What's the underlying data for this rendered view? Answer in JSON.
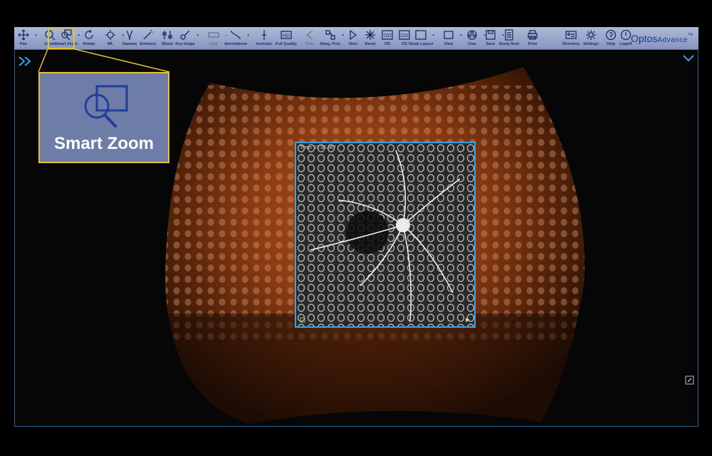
{
  "toolbar": {
    "tools": [
      {
        "label": "Pan",
        "icon": "pan-icon"
      },
      {
        "label": "Zoom",
        "icon": "zoom-icon"
      },
      {
        "label": "Smart Zoom",
        "icon": "smart-zoom-icon",
        "active": true
      },
      {
        "label": "Rotate",
        "icon": "rotate-icon"
      },
      {
        "label": "WL",
        "icon": "window-level-icon"
      },
      {
        "label": "Gamma",
        "icon": "gamma-icon"
      },
      {
        "label": "Enhance",
        "icon": "enhance-wand-icon"
      },
      {
        "label": "Blend",
        "icon": "blend-sliders-icon"
      },
      {
        "label": "Key Image",
        "icon": "key-image-icon"
      },
      {
        "label": "Link",
        "icon": "link-icon",
        "disabled": true
      },
      {
        "label": "Annotations",
        "icon": "annotations-icon"
      },
      {
        "label": "Isotropic",
        "icon": "isotropic-icon"
      },
      {
        "label": "Full Quality",
        "icon": "hd-icon"
      },
      {
        "label": "Prev",
        "icon": "prev-icon",
        "disabled": true
      },
      {
        "label": "Hang. Prot.",
        "icon": "hanging-protocol-icon"
      },
      {
        "label": "Next",
        "icon": "next-icon"
      },
      {
        "label": "Reset",
        "icon": "reset-icon"
      },
      {
        "label": "OD",
        "icon": "od-icon"
      },
      {
        "label": "OS",
        "icon": "os-icon"
      },
      {
        "label": "Study Layout",
        "icon": "study-layout-icon"
      },
      {
        "label": "View",
        "icon": "view-icon"
      },
      {
        "label": "Cine",
        "icon": "cine-icon"
      },
      {
        "label": "Save",
        "icon": "save-icon"
      },
      {
        "label": "Study Note",
        "icon": "study-note-icon"
      },
      {
        "label": "Print",
        "icon": "print-icon"
      },
      {
        "label": "Directory",
        "icon": "directory-icon"
      },
      {
        "label": "Settings",
        "icon": "settings-gear-icon"
      },
      {
        "label": "Help",
        "icon": "help-icon"
      },
      {
        "label": "Logoff",
        "icon": "logoff-power-icon"
      }
    ],
    "brand_main": "Optos",
    "brand_sub": "Advance",
    "brand_tm": "TM"
  },
  "callout": {
    "label": "Smart Zoom",
    "icon": "smart-zoom-icon"
  },
  "viewer": {
    "timer_text": "Timer 01:36.367"
  },
  "colors": {
    "toolbar_bg": "#9aa6cc",
    "highlight": "#e2c230",
    "zoom_border": "#3aa0e8",
    "frame_border": "#2c5f8f"
  }
}
